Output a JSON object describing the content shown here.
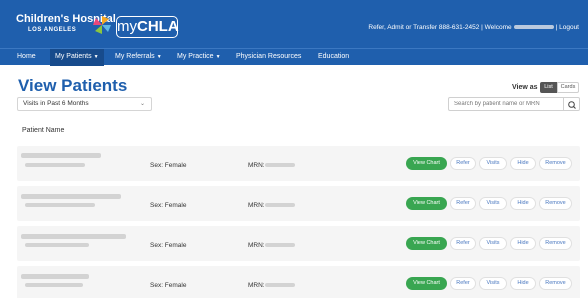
{
  "header": {
    "logo_title": "Children's Hospital",
    "logo_subtitle": "LOS ANGELES",
    "app_name_prefix": "my",
    "app_name_suffix": "CHLA",
    "refer_text": "Refer, Admit or Transfer 888-631-2452 | Welcome",
    "logout_text": "| Logout"
  },
  "nav": {
    "items": [
      {
        "label": "Home",
        "has_dropdown": false
      },
      {
        "label": "My Patients",
        "has_dropdown": true,
        "active": true
      },
      {
        "label": "My Referrals",
        "has_dropdown": true
      },
      {
        "label": "My Practice",
        "has_dropdown": true
      },
      {
        "label": "Physician Resources",
        "has_dropdown": false
      },
      {
        "label": "Education",
        "has_dropdown": false
      }
    ]
  },
  "main": {
    "title": "View Patients",
    "filter": {
      "selected": "Visits in Past 6 Months"
    },
    "view_as": {
      "label": "View as",
      "options": [
        "List",
        "Cards"
      ],
      "selected": "List"
    },
    "search": {
      "placeholder": "Search by patient name or MRN"
    },
    "column_header": "Patient Name",
    "patients": [
      {
        "sex": "Sex: Female",
        "mrn_label": "MRN:"
      },
      {
        "sex": "Sex: Female",
        "mrn_label": "MRN:"
      },
      {
        "sex": "Sex: Female",
        "mrn_label": "MRN:"
      },
      {
        "sex": "Sex: Female",
        "mrn_label": "MRN:"
      }
    ],
    "row_actions": [
      "View Chart",
      "Refer",
      "Visits",
      "Hide",
      "Remove"
    ]
  },
  "colors": {
    "brand_blue": "#1f5fad",
    "nav_active": "#174b8c",
    "primary_green": "#39a651",
    "row_bg": "#f5f5f5"
  }
}
